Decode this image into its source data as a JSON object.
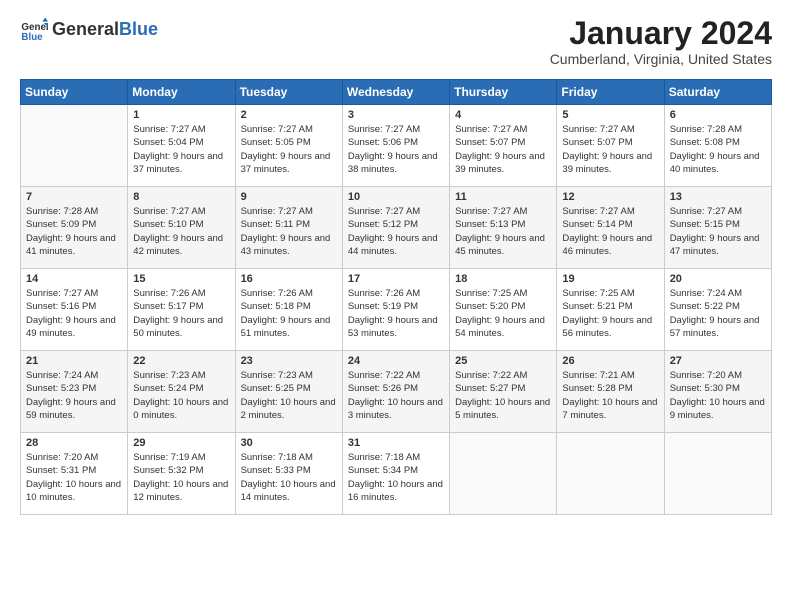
{
  "header": {
    "logo_general": "General",
    "logo_blue": "Blue",
    "month": "January 2024",
    "location": "Cumberland, Virginia, United States"
  },
  "days_of_week": [
    "Sunday",
    "Monday",
    "Tuesday",
    "Wednesday",
    "Thursday",
    "Friday",
    "Saturday"
  ],
  "weeks": [
    [
      {
        "day": "",
        "sunrise": "",
        "sunset": "",
        "daylight": ""
      },
      {
        "day": "1",
        "sunrise": "7:27 AM",
        "sunset": "5:04 PM",
        "daylight": "9 hours and 37 minutes."
      },
      {
        "day": "2",
        "sunrise": "7:27 AM",
        "sunset": "5:05 PM",
        "daylight": "9 hours and 37 minutes."
      },
      {
        "day": "3",
        "sunrise": "7:27 AM",
        "sunset": "5:06 PM",
        "daylight": "9 hours and 38 minutes."
      },
      {
        "day": "4",
        "sunrise": "7:27 AM",
        "sunset": "5:07 PM",
        "daylight": "9 hours and 39 minutes."
      },
      {
        "day": "5",
        "sunrise": "7:27 AM",
        "sunset": "5:07 PM",
        "daylight": "9 hours and 39 minutes."
      },
      {
        "day": "6",
        "sunrise": "7:28 AM",
        "sunset": "5:08 PM",
        "daylight": "9 hours and 40 minutes."
      }
    ],
    [
      {
        "day": "7",
        "sunrise": "7:28 AM",
        "sunset": "5:09 PM",
        "daylight": "9 hours and 41 minutes."
      },
      {
        "day": "8",
        "sunrise": "7:27 AM",
        "sunset": "5:10 PM",
        "daylight": "9 hours and 42 minutes."
      },
      {
        "day": "9",
        "sunrise": "7:27 AM",
        "sunset": "5:11 PM",
        "daylight": "9 hours and 43 minutes."
      },
      {
        "day": "10",
        "sunrise": "7:27 AM",
        "sunset": "5:12 PM",
        "daylight": "9 hours and 44 minutes."
      },
      {
        "day": "11",
        "sunrise": "7:27 AM",
        "sunset": "5:13 PM",
        "daylight": "9 hours and 45 minutes."
      },
      {
        "day": "12",
        "sunrise": "7:27 AM",
        "sunset": "5:14 PM",
        "daylight": "9 hours and 46 minutes."
      },
      {
        "day": "13",
        "sunrise": "7:27 AM",
        "sunset": "5:15 PM",
        "daylight": "9 hours and 47 minutes."
      }
    ],
    [
      {
        "day": "14",
        "sunrise": "7:27 AM",
        "sunset": "5:16 PM",
        "daylight": "9 hours and 49 minutes."
      },
      {
        "day": "15",
        "sunrise": "7:26 AM",
        "sunset": "5:17 PM",
        "daylight": "9 hours and 50 minutes."
      },
      {
        "day": "16",
        "sunrise": "7:26 AM",
        "sunset": "5:18 PM",
        "daylight": "9 hours and 51 minutes."
      },
      {
        "day": "17",
        "sunrise": "7:26 AM",
        "sunset": "5:19 PM",
        "daylight": "9 hours and 53 minutes."
      },
      {
        "day": "18",
        "sunrise": "7:25 AM",
        "sunset": "5:20 PM",
        "daylight": "9 hours and 54 minutes."
      },
      {
        "day": "19",
        "sunrise": "7:25 AM",
        "sunset": "5:21 PM",
        "daylight": "9 hours and 56 minutes."
      },
      {
        "day": "20",
        "sunrise": "7:24 AM",
        "sunset": "5:22 PM",
        "daylight": "9 hours and 57 minutes."
      }
    ],
    [
      {
        "day": "21",
        "sunrise": "7:24 AM",
        "sunset": "5:23 PM",
        "daylight": "9 hours and 59 minutes."
      },
      {
        "day": "22",
        "sunrise": "7:23 AM",
        "sunset": "5:24 PM",
        "daylight": "10 hours and 0 minutes."
      },
      {
        "day": "23",
        "sunrise": "7:23 AM",
        "sunset": "5:25 PM",
        "daylight": "10 hours and 2 minutes."
      },
      {
        "day": "24",
        "sunrise": "7:22 AM",
        "sunset": "5:26 PM",
        "daylight": "10 hours and 3 minutes."
      },
      {
        "day": "25",
        "sunrise": "7:22 AM",
        "sunset": "5:27 PM",
        "daylight": "10 hours and 5 minutes."
      },
      {
        "day": "26",
        "sunrise": "7:21 AM",
        "sunset": "5:28 PM",
        "daylight": "10 hours and 7 minutes."
      },
      {
        "day": "27",
        "sunrise": "7:20 AM",
        "sunset": "5:30 PM",
        "daylight": "10 hours and 9 minutes."
      }
    ],
    [
      {
        "day": "28",
        "sunrise": "7:20 AM",
        "sunset": "5:31 PM",
        "daylight": "10 hours and 10 minutes."
      },
      {
        "day": "29",
        "sunrise": "7:19 AM",
        "sunset": "5:32 PM",
        "daylight": "10 hours and 12 minutes."
      },
      {
        "day": "30",
        "sunrise": "7:18 AM",
        "sunset": "5:33 PM",
        "daylight": "10 hours and 14 minutes."
      },
      {
        "day": "31",
        "sunrise": "7:18 AM",
        "sunset": "5:34 PM",
        "daylight": "10 hours and 16 minutes."
      },
      {
        "day": "",
        "sunrise": "",
        "sunset": "",
        "daylight": ""
      },
      {
        "day": "",
        "sunrise": "",
        "sunset": "",
        "daylight": ""
      },
      {
        "day": "",
        "sunrise": "",
        "sunset": "",
        "daylight": ""
      }
    ]
  ],
  "labels": {
    "sunrise_prefix": "Sunrise: ",
    "sunset_prefix": "Sunset: ",
    "daylight_prefix": "Daylight: "
  }
}
